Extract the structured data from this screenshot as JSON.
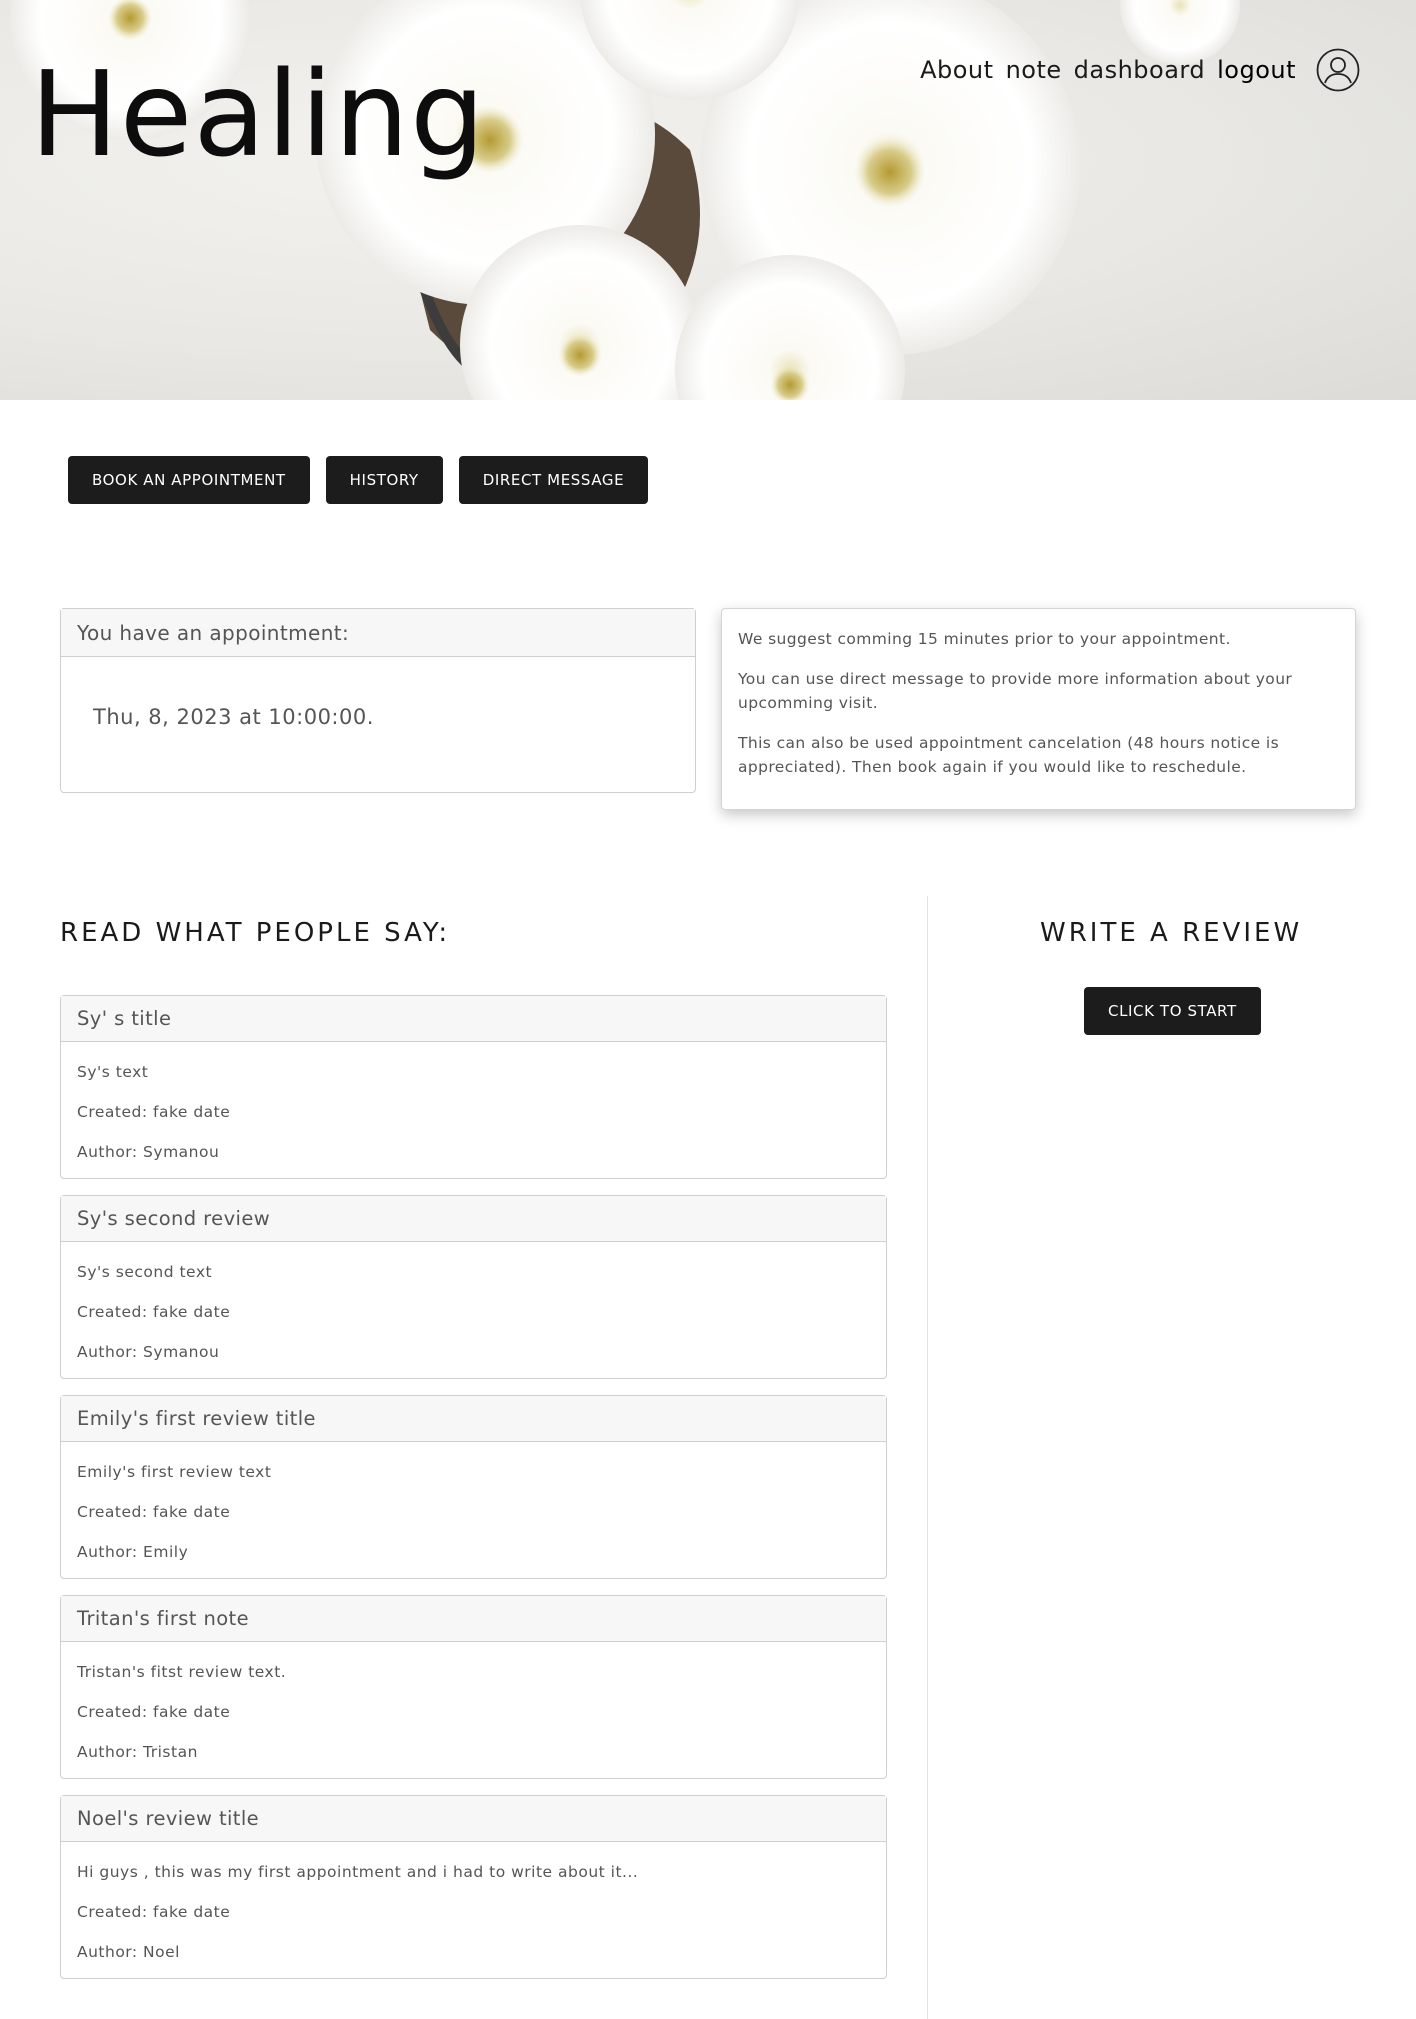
{
  "hero": {
    "site_title": "Healing"
  },
  "nav": {
    "links": [
      "About",
      "note",
      "dashboard",
      "logout"
    ],
    "avatar_icon": "user-avatar-icon"
  },
  "actions": {
    "book": "BOOK AN APPOINTMENT",
    "history": "HISTORY",
    "direct_message": "DIRECT MESSAGE"
  },
  "appointment": {
    "header": "You have an appointment:",
    "datetime": "Thu, 8, 2023 at 10:00:00."
  },
  "notice": {
    "lines": [
      "We suggest comming 15 minutes prior to your appointment.",
      "You can use direct message to provide more information about your upcomming visit.",
      "This can also be used appointment cancelation (48 hours notice is appreciated). Then book again if you would like to reschedule."
    ]
  },
  "reviews": {
    "heading": "READ WHAT PEOPLE SAY:",
    "items": [
      {
        "title": "Sy' s title",
        "text": "Sy's text",
        "created": "Created: fake date",
        "author": "Author: Symanou"
      },
      {
        "title": "Sy's second review",
        "text": "Sy's second text",
        "created": "Created: fake date",
        "author": "Author: Symanou"
      },
      {
        "title": "Emily's first review title",
        "text": "Emily's first review text",
        "created": "Created: fake date",
        "author": "Author: Emily"
      },
      {
        "title": "Tritan's first note",
        "text": "Tristan's fitst review text.",
        "created": "Created: fake date",
        "author": "Author: Tristan"
      },
      {
        "title": "Noel's review title",
        "text": "Hi guys , this was my first appointment and i had to write about it...",
        "created": "Created: fake date",
        "author": "Author: Noel"
      }
    ]
  },
  "write_review": {
    "heading": "WRITE A REVIEW",
    "button": "CLICK TO START"
  },
  "colors": {
    "button_bg": "#1c1c1c",
    "card_header_bg": "#f7f7f7",
    "border": "#cfcfcf"
  }
}
